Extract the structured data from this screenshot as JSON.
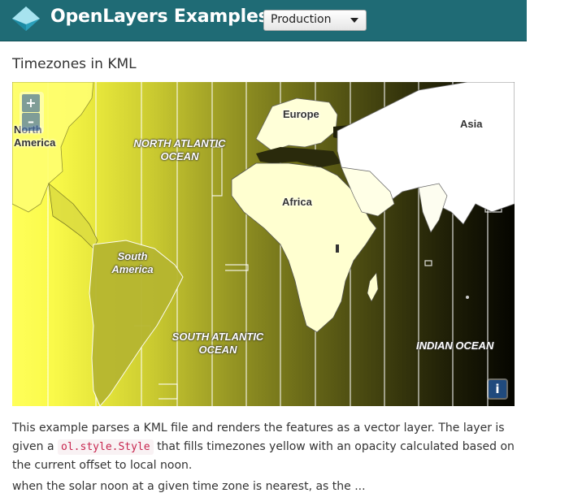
{
  "navbar": {
    "brand": "OpenLayers Examples",
    "version_select": {
      "selected": "Production"
    },
    "background_color": "#1f6b75"
  },
  "page": {
    "title": "Timezones in KML"
  },
  "map": {
    "labels": {
      "north_america": "North America",
      "north_atlantic": "NORTH ATLANTIC OCEAN",
      "europe": "Europe",
      "asia": "Asia",
      "africa": "Africa",
      "south_america": "South America",
      "south_atlantic": "SOUTH ATLANTIC OCEAN",
      "indian_ocean": "INDIAN OCEAN"
    },
    "controls": {
      "zoom_in": "+",
      "zoom_out": "–",
      "attribution": "i"
    }
  },
  "description": {
    "part1": "This example parses a KML file and renders the features as a vector layer. The layer is given a",
    "code": "ol.style.Style",
    "part2": "that fills timezones yellow with an opacity calculated based on the current offset to local noon."
  },
  "description_cutoff": "when the solar noon at a given time zone is nearest, as the ..."
}
